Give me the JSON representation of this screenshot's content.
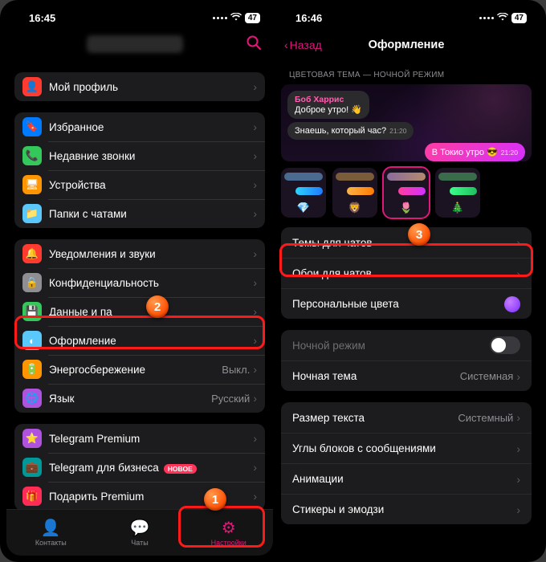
{
  "left": {
    "time": "16:45",
    "battery": "47",
    "profile": "Мой профиль",
    "g1": {
      "fav": "Избранное",
      "calls": "Недавние звонки",
      "dev": "Устройства",
      "folders": "Папки с чатами"
    },
    "g2": {
      "notif": "Уведомления и звуки",
      "priv": "Конфиденциальность",
      "data": "Данные и па",
      "appear": "Оформление",
      "power": "Энергосбережение",
      "power_val": "Выкл.",
      "lang": "Язык",
      "lang_val": "Русский"
    },
    "g3": {
      "prem": "Telegram Premium",
      "biz": "Telegram для бизнеса",
      "biz_badge": "НОВОЕ",
      "gift": "Подарить Premium"
    },
    "tabs": {
      "contacts": "Контакты",
      "chats": "Чаты",
      "settings": "Настройки"
    }
  },
  "right": {
    "time": "16:46",
    "battery": "47",
    "back": "Назад",
    "title": "Оформление",
    "section": "ЦВЕТОВАЯ ТЕМА — НОЧНОЙ РЕЖИМ",
    "chat": {
      "sender": "Боб Харрис",
      "msg1": "Доброе утро! 👋",
      "msg2": "Знаешь, который час?",
      "t1": "21:20",
      "out": "В Токио утро 😎",
      "t2": "21:20"
    },
    "themes_emoji": [
      "💎",
      "🦁",
      "🌷",
      "🎄"
    ],
    "rows": {
      "themes": "Темы для чатов",
      "wallpaper": "Обои для чатов",
      "colors": "Персональные цвета",
      "night": "Ночной режим",
      "night_theme": "Ночная тема",
      "night_theme_val": "Системная",
      "text": "Размер текста",
      "text_val": "Системный",
      "corners": "Углы блоков с сообщениями",
      "anim": "Анимации",
      "stickers": "Стикеры и эмодзи"
    }
  },
  "callouts": {
    "1": "1",
    "2": "2",
    "3": "3"
  }
}
